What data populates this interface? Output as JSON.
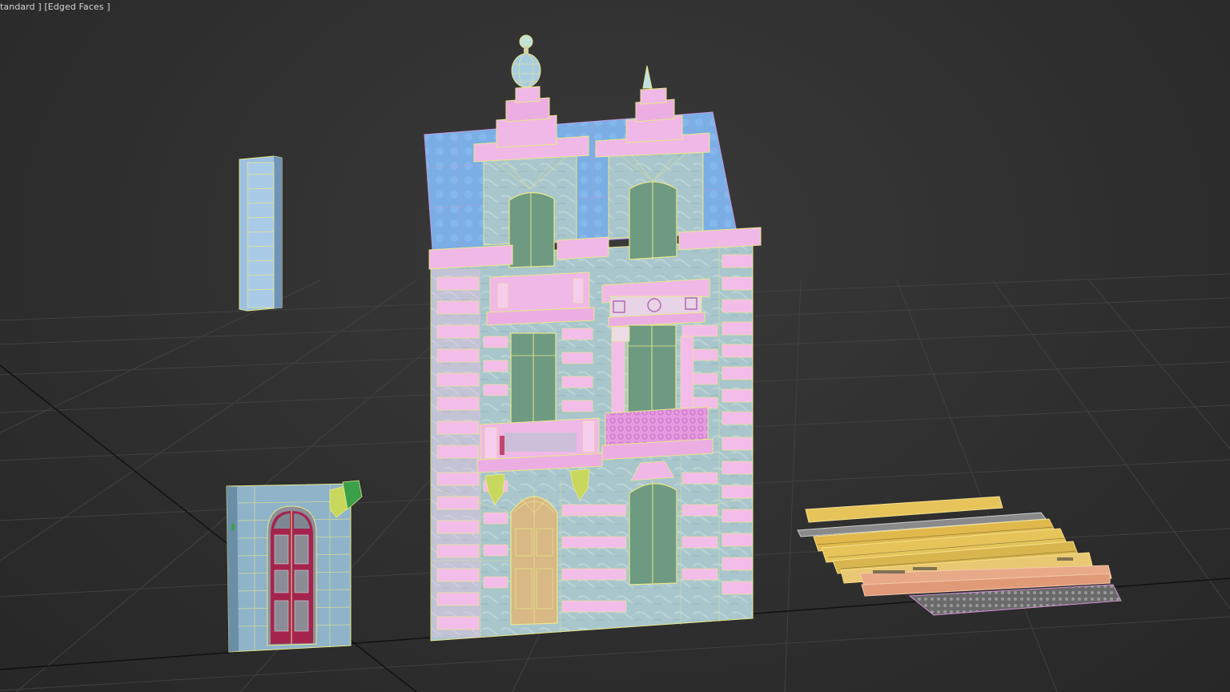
{
  "viewport": {
    "label": "tandard ] [Edged Faces ]"
  },
  "scene_objects": [
    "window-shutter-panel",
    "entrance-door-module",
    "townhouse-facade",
    "trim-and-railing-parts"
  ],
  "colors": {
    "background": "#2f2f2f",
    "grid_line": "#3f3f3f",
    "roof_blue": "#7aaee4",
    "stone_blue": "#a9c6cc",
    "trim_pink": "#f0b8e6",
    "window_green": "#6e9a82",
    "wire_yellow": "#e8e88a",
    "door_red": "#a4244e",
    "trim_gold": "#e6c45a",
    "trim_peach": "#e7a988"
  }
}
